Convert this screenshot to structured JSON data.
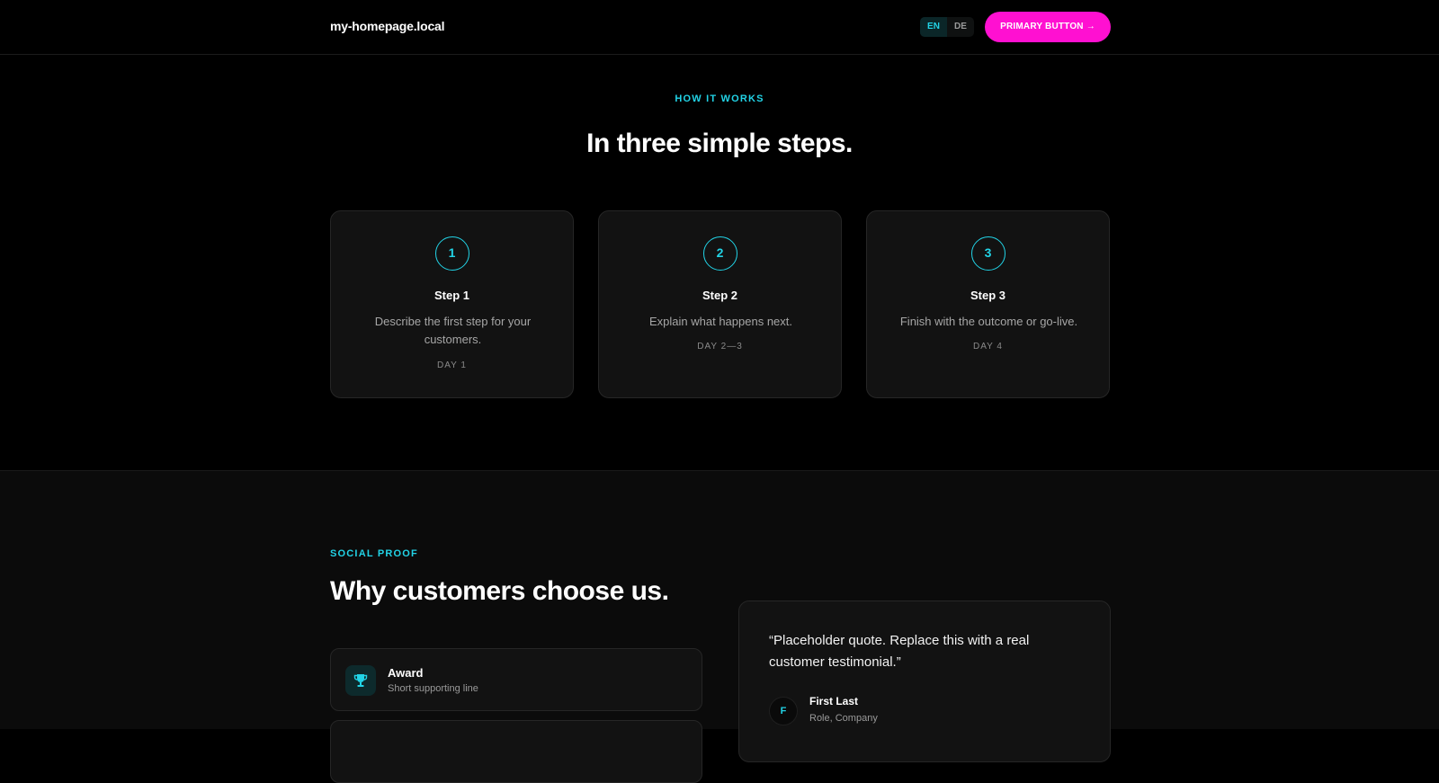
{
  "header": {
    "logo": "my-homepage.local",
    "lang": [
      {
        "label": "EN",
        "active": true
      },
      {
        "label": "DE",
        "active": false
      }
    ],
    "primary_button": "PRIMARY BUTTON →"
  },
  "how": {
    "eyebrow": "HOW IT WORKS",
    "title": "In three simple steps.",
    "steps": [
      {
        "number": "1",
        "title": "Step 1",
        "description": "Describe the first step for your customers.",
        "day": "DAY 1"
      },
      {
        "number": "2",
        "title": "Step 2",
        "description": "Explain what happens next.",
        "day": "DAY 2—3"
      },
      {
        "number": "3",
        "title": "Step 3",
        "description": "Finish with the outcome or go-live.",
        "day": "DAY 4"
      }
    ]
  },
  "social": {
    "eyebrow": "SOCIAL PROOF",
    "title": "Why customers choose us.",
    "highlights": [
      {
        "icon": "trophy-icon",
        "title": "Award",
        "subtitle": "Short supporting line"
      }
    ],
    "testimonial": {
      "quote": "“Placeholder quote. Replace this with a real customer testimonial.”",
      "avatar_initial": "F",
      "name": "First Last",
      "role": "Role, Company"
    }
  },
  "colors": {
    "accent": "#22d3e6",
    "primary": "#ff10d1",
    "background": "#000000",
    "card": "#121212"
  }
}
